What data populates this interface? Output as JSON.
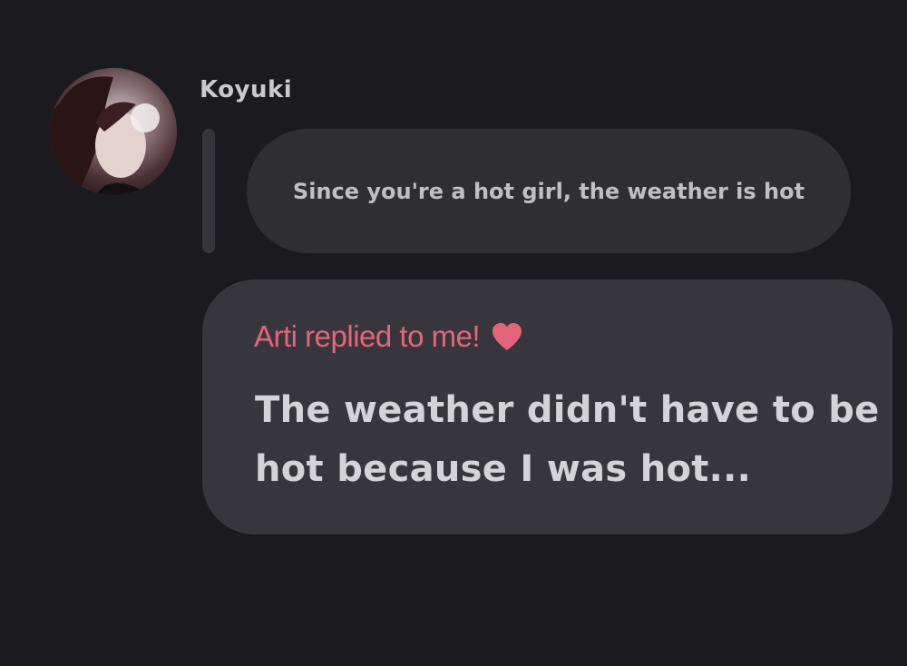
{
  "message": {
    "sender": {
      "name": "Koyuki",
      "avatar_icon": "profile-photo"
    },
    "quoted_text": "Since you're a hot girl, the weather is hot",
    "reply": {
      "label": "Arti replied to me!",
      "label_color": "#e4657a",
      "heart_icon": "heart-icon",
      "line1": "The weather didn't have to be",
      "line2": "hot because I was hot..."
    }
  },
  "colors": {
    "background": "#1b1b1f",
    "quoted_bubble": "#2e2e33",
    "reply_bubble": "#36363c",
    "text": "#d3d3d8"
  }
}
